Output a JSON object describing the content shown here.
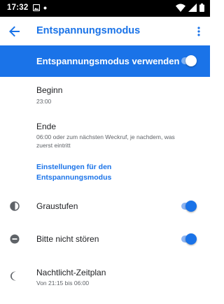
{
  "status_bar": {
    "time": "17:32",
    "left_icons": [
      "image-notification-icon",
      "dot-notification-icon"
    ],
    "right_icons": [
      "wifi-icon",
      "signal-icon",
      "battery-icon"
    ]
  },
  "app_bar": {
    "title": "Entspannungsmodus",
    "back_icon": "arrow-back-icon",
    "more_icon": "more-vert-icon"
  },
  "master_switch": {
    "label": "Entspannungsmodus verwenden",
    "enabled": true
  },
  "schedule": {
    "start": {
      "title": "Beginn",
      "value": "23:00"
    },
    "end": {
      "title": "Ende",
      "value": "06:00 oder zum nächsten Weckruf, je nachdem, was zuerst eintritt"
    }
  },
  "settings_link": "Einstellungen für den Entspannungsmodus",
  "options": [
    {
      "label": "Graustufen",
      "icon": "grayscale-icon",
      "enabled": true
    },
    {
      "label": "Bitte nicht stören",
      "icon": "do-not-disturb-icon",
      "enabled": true
    }
  ],
  "night_light": {
    "title": "Nachtlicht-Zeitplan",
    "subtitle": "Von 21:15 bis 06:00",
    "icon": "moon-icon"
  },
  "colors": {
    "accent": "#1a73e8",
    "status_bar": "#000000",
    "toggle_track": "#8cb4f2"
  }
}
